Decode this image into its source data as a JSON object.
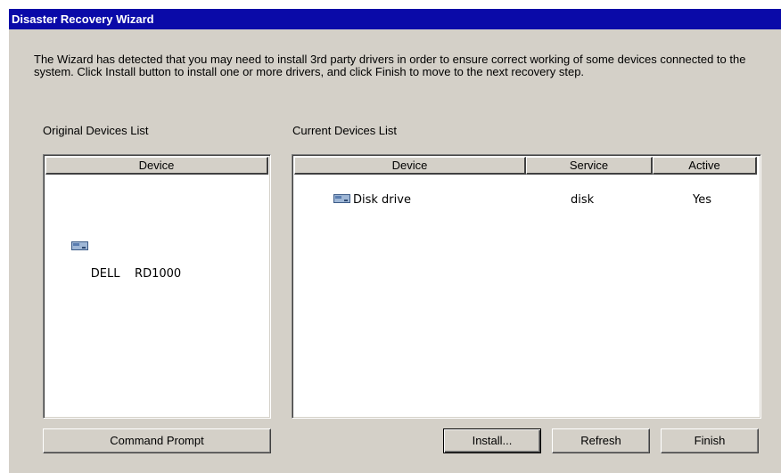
{
  "window": {
    "title": "Disaster Recovery Wizard",
    "intro": "The Wizard has detected that you may need to install 3rd party drivers in order to ensure correct working of some devices connected to the system. Click Install button to install one or more drivers, and click Finish to move to the next recovery step."
  },
  "original_list": {
    "label": "Original Devices List",
    "columns": [
      "Device"
    ],
    "rows": [
      {
        "device": "DELL    RD1000",
        "icon": "disk-drive-icon"
      }
    ]
  },
  "current_list": {
    "label": "Current Devices List",
    "columns": [
      "Device",
      "Service",
      "Active"
    ],
    "rows": [
      {
        "device": "Disk drive",
        "service": "disk",
        "active": "Yes",
        "icon": "disk-drive-icon"
      }
    ]
  },
  "buttons": {
    "command_prompt": "Command Prompt",
    "install": "Install...",
    "refresh": "Refresh",
    "finish": "Finish"
  },
  "colors": {
    "title_bar": "#0a0aa8",
    "dialog_face": "#d4d0c8"
  }
}
